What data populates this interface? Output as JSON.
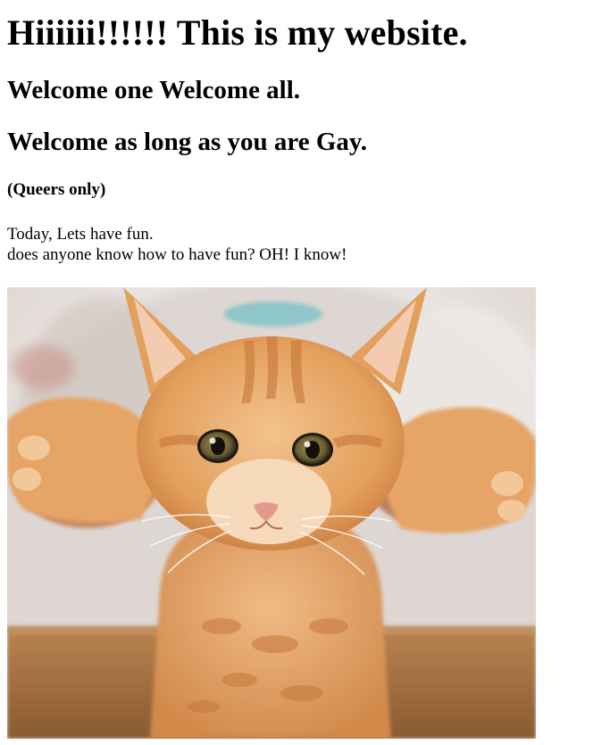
{
  "heading_main": "Hiiiiii!!!!!! This is my website.",
  "heading_welcome_1": "Welcome one Welcome all.",
  "heading_welcome_2": "Welcome as long as you are Gay.",
  "heading_small": "(Queers only)",
  "paragraph": {
    "line1": "Today, Lets have fun.",
    "line2": "does anyone know how to have fun? OH! I know!"
  },
  "image": {
    "subject": "orange-tabby-kitten-photo",
    "colors": {
      "kitten_fur": "#e7a25f",
      "kitten_stripes": "#c9783c",
      "background_light": "#ece7e4",
      "hand_skin": "#c98b66",
      "table_wood": "#a06f3e",
      "collar": "#8fc6c9"
    }
  }
}
